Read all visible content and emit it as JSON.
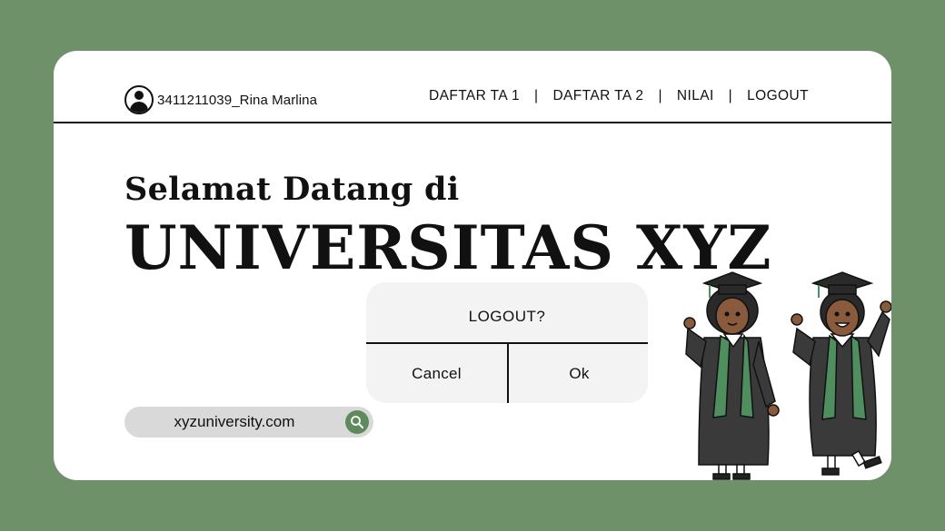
{
  "user": {
    "name": "3411211039_Rina Marlina"
  },
  "nav": {
    "items": [
      {
        "label": "DAFTAR TA 1"
      },
      {
        "label": "DAFTAR TA 2"
      },
      {
        "label": "NILAI"
      },
      {
        "label": "LOGOUT"
      }
    ],
    "separator": "|"
  },
  "hero": {
    "welcome": "Selamat Datang di",
    "title": "UNIVERSITAS XYZ"
  },
  "search": {
    "value": "xyzuniversity.com",
    "icon": "search-icon"
  },
  "dialog": {
    "title": "LOGOUT?",
    "cancel_label": "Cancel",
    "ok_label": "Ok"
  },
  "colors": {
    "background": "#6f9169",
    "card": "#ffffff",
    "accent_green": "#5e8a5e",
    "stole_green": "#4f8f5f"
  }
}
